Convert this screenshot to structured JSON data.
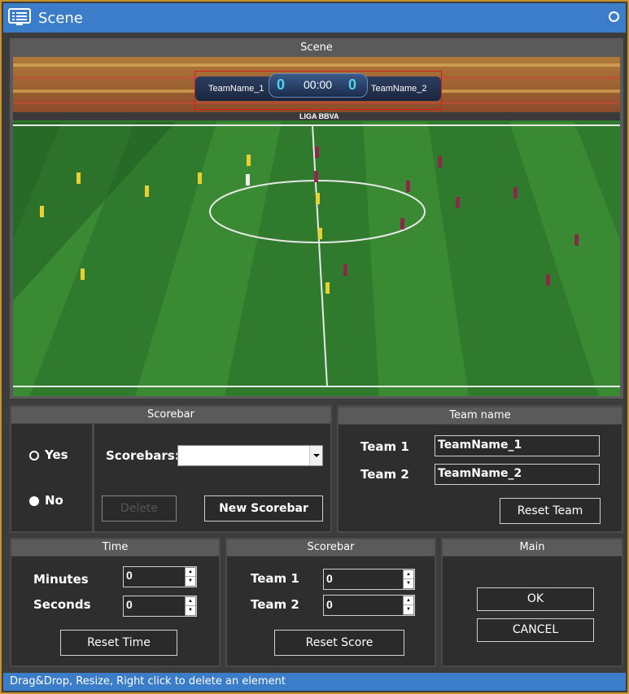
{
  "window": {
    "title": "Scene"
  },
  "scene": {
    "header": "Scene",
    "scoreboard": {
      "team1": "TeamName_1",
      "team2": "TeamName_2",
      "score1": "0",
      "score2": "0",
      "clock": "00:00"
    },
    "sponsor_text": "LIGA BBVA"
  },
  "scorebar_panel": {
    "header": "Scorebar",
    "yes_label": "Yes",
    "no_label": "No",
    "selected": "No",
    "scorebars_label": "Scorebars:",
    "scorebars_value": "",
    "delete_label": "Delete",
    "new_label": "New Scorebar"
  },
  "team_panel": {
    "header": "Team name",
    "team1_label": "Team 1",
    "team2_label": "Team 2",
    "team1_value": "TeamName_1",
    "team2_value": "TeamName_2",
    "reset_label": "Reset Team"
  },
  "time_panel": {
    "header": "Time",
    "minutes_label": "Minutes",
    "seconds_label": "Seconds",
    "minutes_value": "0",
    "seconds_value": "0",
    "reset_label": "Reset Time"
  },
  "score_panel": {
    "header": "Scorebar",
    "team1_label": "Team 1",
    "team2_label": "Team 2",
    "team1_value": "0",
    "team2_value": "0",
    "reset_label": "Reset Score"
  },
  "main_panel": {
    "header": "Main",
    "ok_label": "OK",
    "cancel_label": "CANCEL"
  },
  "status": {
    "text": "Drag&Drop,  Resize,  Right click to delete an element"
  },
  "colors": {
    "titlebar": "#3b7dc8",
    "border": "#c8902a",
    "panel": "#2e2e2e",
    "panel_header": "#5a5a5a"
  }
}
